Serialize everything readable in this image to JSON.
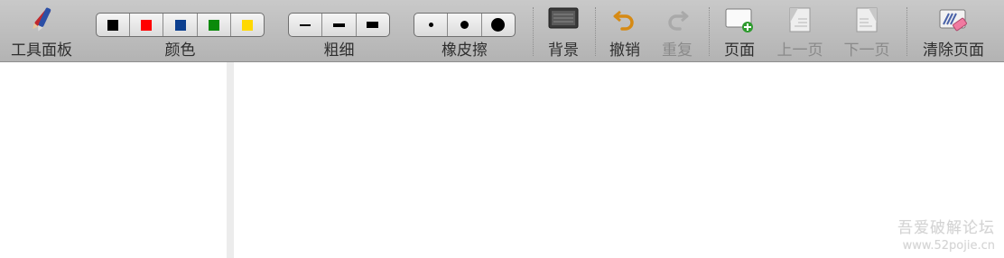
{
  "toolbar": {
    "toolbox": {
      "label": "工具面板",
      "icon": "pens-icon"
    },
    "color": {
      "label": "颜色",
      "swatches": [
        "#000000",
        "#ff0000",
        "#0c3f8f",
        "#0a8a0a",
        "#ffd800"
      ]
    },
    "thickness": {
      "label": "粗细"
    },
    "eraser": {
      "label": "橡皮擦"
    },
    "background": {
      "label": "背景",
      "icon": "background-board-icon"
    },
    "undo": {
      "label": "撤销",
      "icon": "undo-arrow-icon"
    },
    "redo": {
      "label": "重复",
      "icon": "redo-arrow-icon",
      "enabled": false
    },
    "page": {
      "label": "页面",
      "icon": "add-page-icon"
    },
    "prev_page": {
      "label": "上一页",
      "icon": "previous-page-icon",
      "enabled": false
    },
    "next_page": {
      "label": "下一页",
      "icon": "next-page-icon",
      "enabled": false
    },
    "clear_page": {
      "label": "清除页面",
      "icon": "clear-page-eraser-icon"
    }
  },
  "side_tab": {
    "icon": "expand-panel-icon"
  },
  "watermark": {
    "line1": "吾爱破解论坛",
    "line2": "www.52pojie.cn"
  }
}
